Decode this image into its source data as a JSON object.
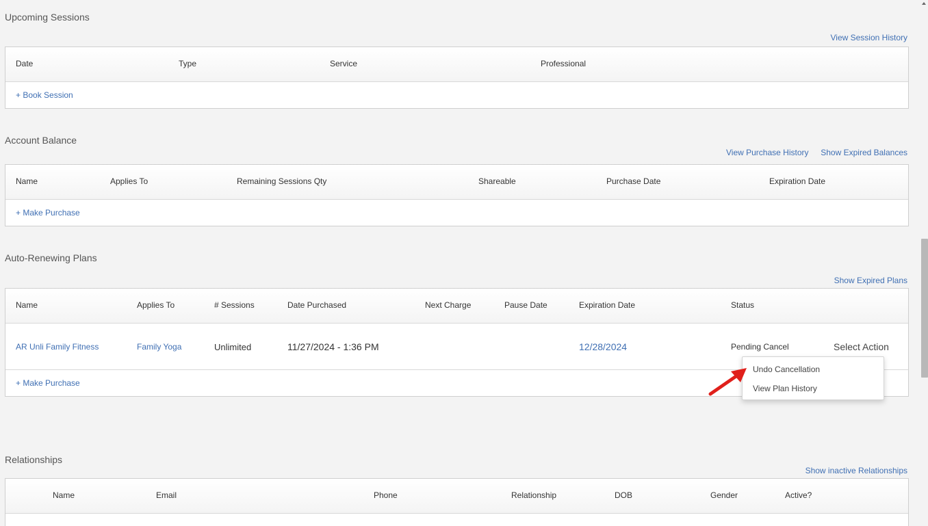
{
  "upcoming": {
    "title": "Upcoming Sessions",
    "history_link": "View Session History",
    "headers": [
      "Date",
      "Type",
      "Service",
      "Professional"
    ],
    "add_link": "+ Book Session"
  },
  "balance": {
    "title": "Account Balance",
    "purchase_history_link": "View Purchase History",
    "expired_link": "Show Expired Balances",
    "headers": [
      "Name",
      "Applies To",
      "Remaining Sessions Qty",
      "Shareable",
      "Purchase Date",
      "Expiration Date"
    ],
    "add_link": "+ Make Purchase"
  },
  "plans": {
    "title": "Auto-Renewing Plans",
    "expired_link": "Show Expired Plans",
    "headers": [
      "Name",
      "Applies To",
      "# Sessions",
      "Date Purchased",
      "Next Charge",
      "Pause Date",
      "Expiration Date",
      "Status"
    ],
    "row": {
      "name": "AR Unli Family Fitness",
      "applies_to": "Family Yoga",
      "sessions": "Unlimited",
      "date_purchased": "11/27/2024 - 1:36 PM",
      "next_charge": "",
      "pause_date": "",
      "expiration_date": "12/28/2024",
      "status": "Pending Cancel",
      "action": "Select Action"
    },
    "add_link": "+ Make Purchase"
  },
  "action_menu": {
    "items": [
      "Undo Cancellation",
      "View Plan History"
    ]
  },
  "relationships": {
    "title": "Relationships",
    "inactive_link": "Show inactive Relationships",
    "headers": [
      "Name",
      "Email",
      "Phone",
      "Relationship",
      "DOB",
      "Gender",
      "Active?"
    ]
  },
  "colors": {
    "link": "#3f6fb3",
    "arrow": "#e0201b",
    "background": "#f3f3f3"
  }
}
